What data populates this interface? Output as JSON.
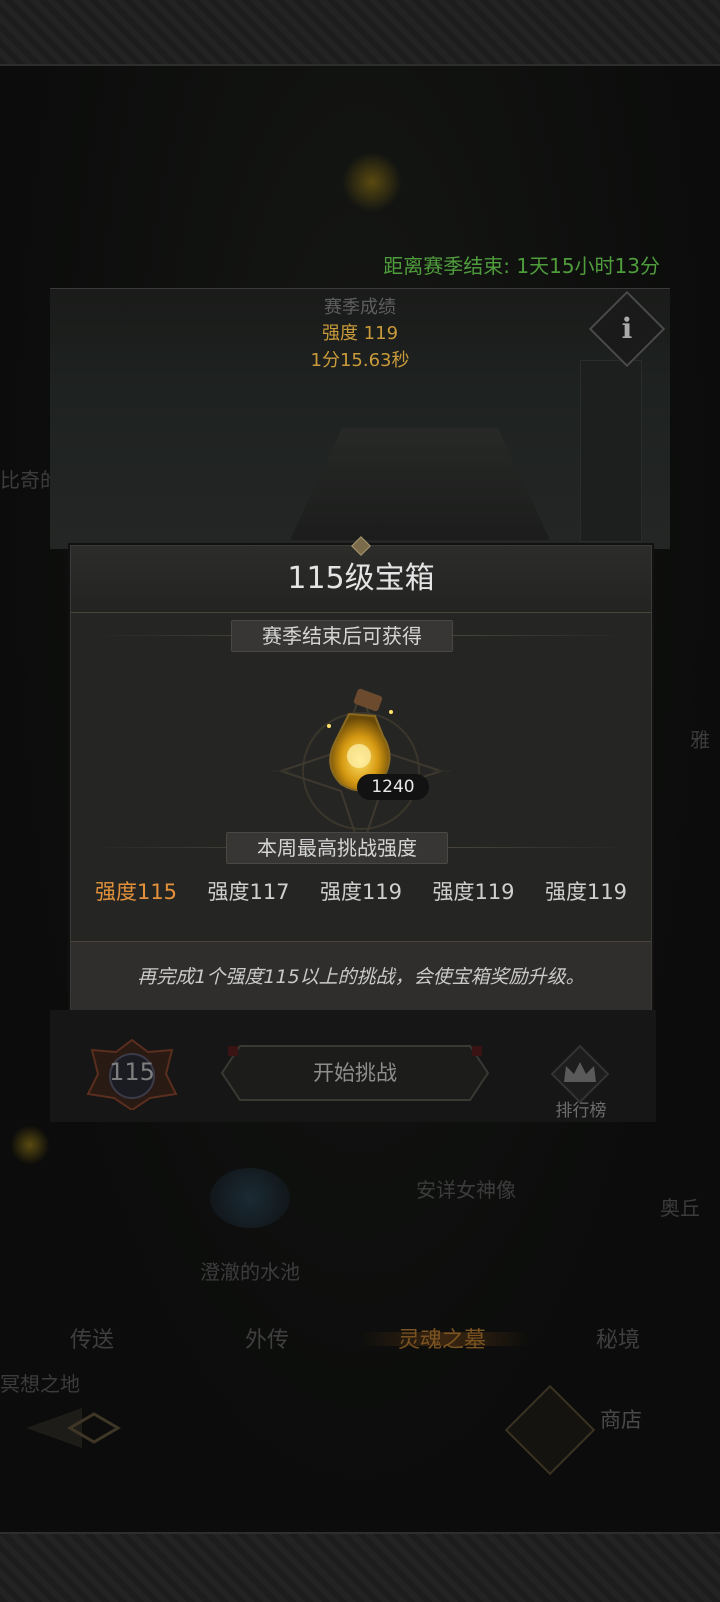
{
  "season": {
    "timer_text": "距离赛季结束: 1天15小时13分",
    "title": "赛季成绩",
    "strength": "强度 119",
    "time": "1分15.63秒",
    "info_icon": "i"
  },
  "modal": {
    "title": "115级宝箱",
    "reward_header": "赛季结束后可获得",
    "reward_item": {
      "icon": "potion-bottle-icon",
      "count": "1240"
    },
    "weekly_header": "本周最高挑战强度",
    "weekly_strengths": [
      {
        "label": "强度115",
        "highlight": true
      },
      {
        "label": "强度117",
        "highlight": false
      },
      {
        "label": "强度119",
        "highlight": false
      },
      {
        "label": "强度119",
        "highlight": false
      },
      {
        "label": "强度119",
        "highlight": false
      }
    ],
    "footer_hint": "再完成1个强度115以上的挑战，会使宝箱奖励升级。"
  },
  "challenge": {
    "level": "115",
    "start_label": "开始挑战",
    "ranking_label": "排行榜"
  },
  "map": {
    "labels": [
      "比奇的",
      "安详女神像",
      "澄澈的水池",
      "冥想之地",
      "雅",
      "奥丘"
    ]
  },
  "nav": {
    "tabs": [
      "传送",
      "外传",
      "灵魂之墓",
      "秘境"
    ],
    "active_tab": "灵魂之墓",
    "shop_label": "商店"
  },
  "colors": {
    "timer_green": "#4f9c3c",
    "strength_gold": "#c89a3a",
    "highlight_orange": "#e3923b",
    "modal_bg": "#252524"
  }
}
